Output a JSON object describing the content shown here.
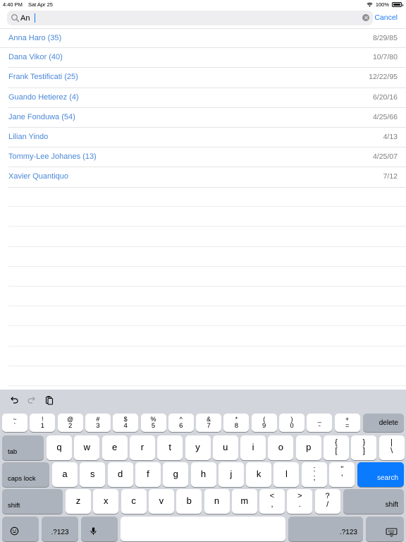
{
  "status_bar": {
    "time": "4:40 PM",
    "date": "Sat Apr 25",
    "battery": "100%"
  },
  "search": {
    "value": "An",
    "cancel_label": "Cancel"
  },
  "results": [
    {
      "name": "Anna Haro (35)",
      "date": "8/29/85"
    },
    {
      "name": "Dana Vikor (40)",
      "date": "10/7/80"
    },
    {
      "name": "Frank Testificati (25)",
      "date": "12/22/95"
    },
    {
      "name": "Guando Hetierez (4)",
      "date": "6/20/16"
    },
    {
      "name": "Jane Fonduwa (54)",
      "date": "4/25/66"
    },
    {
      "name": "Lilian Yindo",
      "date": "4/13"
    },
    {
      "name": "Tommy-Lee Johanes (13)",
      "date": "4/25/07"
    },
    {
      "name": "Xavier Quantiquo",
      "date": "7/12"
    }
  ],
  "keyboard": {
    "number_row": [
      {
        "top": "~",
        "bottom": "`"
      },
      {
        "top": "!",
        "bottom": "1"
      },
      {
        "top": "@",
        "bottom": "2"
      },
      {
        "top": "#",
        "bottom": "3"
      },
      {
        "top": "$",
        "bottom": "4"
      },
      {
        "top": "%",
        "bottom": "5"
      },
      {
        "top": "^",
        "bottom": "6"
      },
      {
        "top": "&",
        "bottom": "7"
      },
      {
        "top": "*",
        "bottom": "8"
      },
      {
        "top": "(",
        "bottom": "9"
      },
      {
        "top": ")",
        "bottom": "0"
      },
      {
        "top": "_",
        "bottom": "-"
      },
      {
        "top": "+",
        "bottom": "="
      }
    ],
    "delete_label": "delete",
    "tab_label": "tab",
    "row_q": [
      "q",
      "w",
      "e",
      "r",
      "t",
      "y",
      "u",
      "i",
      "o",
      "p"
    ],
    "row_q_extra": [
      {
        "top": "{",
        "bottom": "["
      },
      {
        "top": "}",
        "bottom": "]"
      },
      {
        "top": "|",
        "bottom": "\\"
      }
    ],
    "caps_label": "caps lock",
    "row_a": [
      "a",
      "s",
      "d",
      "f",
      "g",
      "h",
      "j",
      "k",
      "l"
    ],
    "row_a_extra": [
      {
        "top": ":",
        "bottom": ";"
      },
      {
        "top": "\"",
        "bottom": "'"
      }
    ],
    "search_label": "search",
    "shift_label": "shift",
    "row_z": [
      "z",
      "x",
      "c",
      "v",
      "b",
      "n",
      "m"
    ],
    "row_z_extra": [
      {
        "top": "<",
        "bottom": ","
      },
      {
        "top": ">",
        "bottom": "."
      },
      {
        "top": "?",
        "bottom": "/"
      }
    ],
    "numbers_label": ".?123",
    "accent_color": "#0a7aff",
    "icons": [
      "undo-icon",
      "redo-icon",
      "paste-icon",
      "emoji-icon",
      "microphone-icon",
      "keyboard-dismiss-icon"
    ]
  }
}
